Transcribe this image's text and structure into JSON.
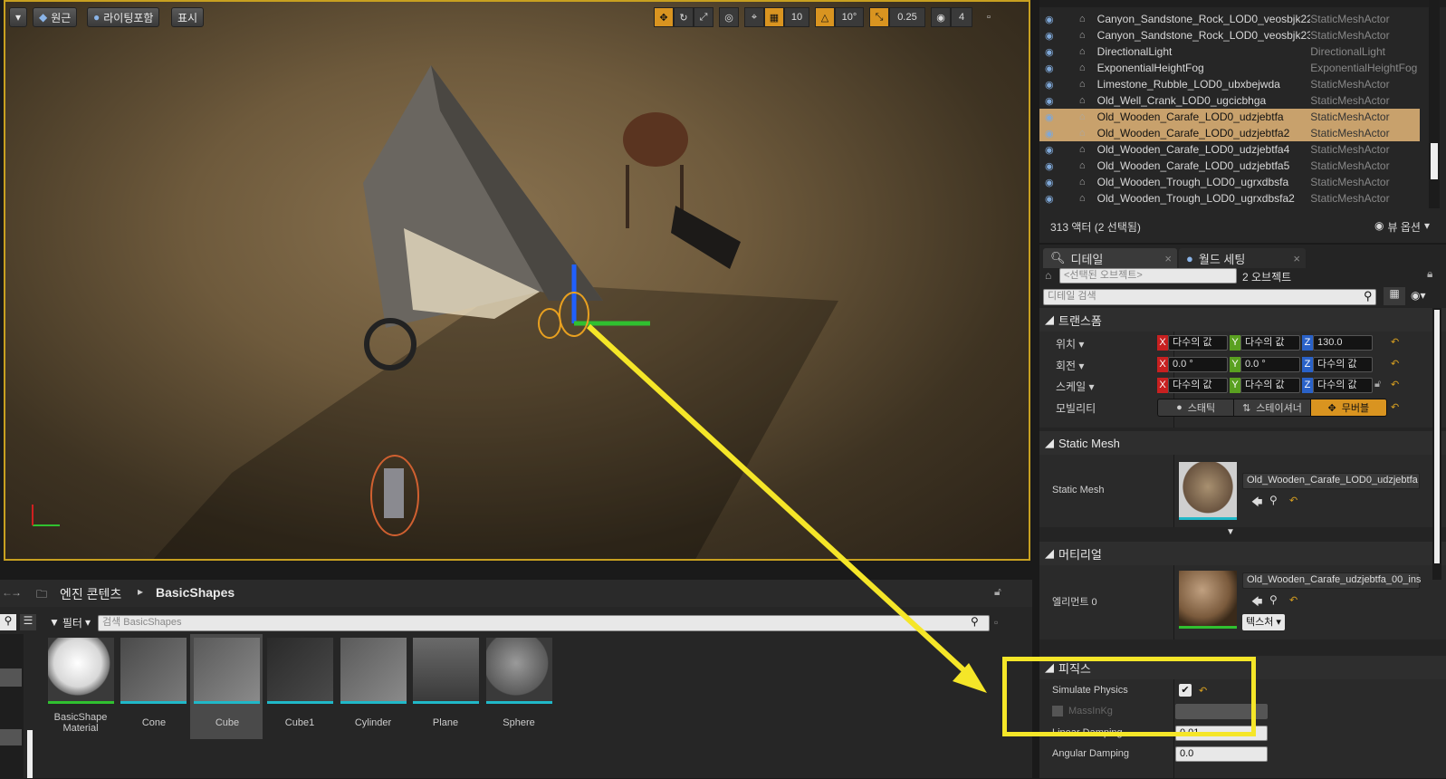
{
  "viewport": {
    "toolbar_left": {
      "perspective_label": "원근",
      "lighting_label": "라이팅포함",
      "show_label": "표시"
    },
    "toolbar_right": {
      "grid_snap": "10",
      "rot_snap": "10°",
      "scale_snap": "0.25",
      "cam_speed": "4"
    }
  },
  "outliner": {
    "rows": [
      {
        "name": "Canyon_Sandstone_Rock_LOD0_veosbjk22",
        "type": "StaticMeshActor"
      },
      {
        "name": "Canyon_Sandstone_Rock_LOD0_veosbjk23",
        "type": "StaticMeshActor"
      },
      {
        "name": "DirectionalLight",
        "type": "DirectionalLight"
      },
      {
        "name": "ExponentialHeightFog",
        "type": "ExponentialHeightFog"
      },
      {
        "name": "Limestone_Rubble_LOD0_ubxbejwda",
        "type": "StaticMeshActor"
      },
      {
        "name": "Old_Well_Crank_LOD0_ugcicbhga",
        "type": "StaticMeshActor"
      },
      {
        "name": "Old_Wooden_Carafe_LOD0_udzjebtfa",
        "type": "StaticMeshActor"
      },
      {
        "name": "Old_Wooden_Carafe_LOD0_udzjebtfa2",
        "type": "StaticMeshActor"
      },
      {
        "name": "Old_Wooden_Carafe_LOD0_udzjebtfa4",
        "type": "StaticMeshActor"
      },
      {
        "name": "Old_Wooden_Carafe_LOD0_udzjebtfa5",
        "type": "StaticMeshActor"
      },
      {
        "name": "Old_Wooden_Trough_LOD0_ugrxdbsfa",
        "type": "StaticMeshActor"
      },
      {
        "name": "Old_Wooden_Trough_LOD0_ugrxdbsfa2",
        "type": "StaticMeshActor"
      }
    ],
    "actor_count": "313 액터 (2 선택됨)",
    "view_options": "뷰 옵션"
  },
  "details": {
    "tab_details": "디테일",
    "tab_world": "월드 세팅",
    "selected_placeholder": "<선택된 오브젝트>",
    "object_count": "2 오브젝트",
    "search_placeholder": "디테일 검색",
    "transform": {
      "header": "트랜스폼",
      "location_label": "위치",
      "rotation_label": "회전",
      "scale_label": "스케일",
      "mobility_label": "모빌리티",
      "loc": [
        "다수의 값",
        "다수의 값",
        "130.0"
      ],
      "rot": [
        "0.0 °",
        "0.0 °",
        "다수의 값"
      ],
      "scale": [
        "다수의 값",
        "다수의 값",
        "다수의 값"
      ],
      "mobility": [
        "스태틱",
        "스테이셔너",
        "무버블"
      ]
    },
    "static_mesh": {
      "header": "Static Mesh",
      "label": "Static Mesh",
      "value": "Old_Wooden_Carafe_LOD0_udzjebtfa"
    },
    "materials": {
      "header": "머티리얼",
      "label": "엘리먼트 0",
      "value": "Old_Wooden_Carafe_udzjebtfa_00_ins",
      "texture_btn": "텍스처"
    },
    "physics": {
      "header": "피직스",
      "simulate_label": "Simulate Physics",
      "mass_label": "MassInKg",
      "linear_label": "Linear Damping",
      "linear_value": "0.01",
      "angular_label": "Angular Damping",
      "angular_value": "0.0"
    }
  },
  "content_browser": {
    "path_root": "엔진 콘텐츠",
    "path_folder": "BasicShapes",
    "filter_label": "필터",
    "search_placeholder": "검색 BasicShapes",
    "assets": [
      {
        "label": "BasicShape Material"
      },
      {
        "label": "Cone"
      },
      {
        "label": "Cube"
      },
      {
        "label": "Cube1"
      },
      {
        "label": "Cylinder"
      },
      {
        "label": "Plane"
      },
      {
        "label": "Sphere"
      }
    ]
  },
  "colors": {
    "selection": "#c8a16c",
    "accent_orange": "#d99420",
    "annotation_yellow": "#f5e628"
  }
}
